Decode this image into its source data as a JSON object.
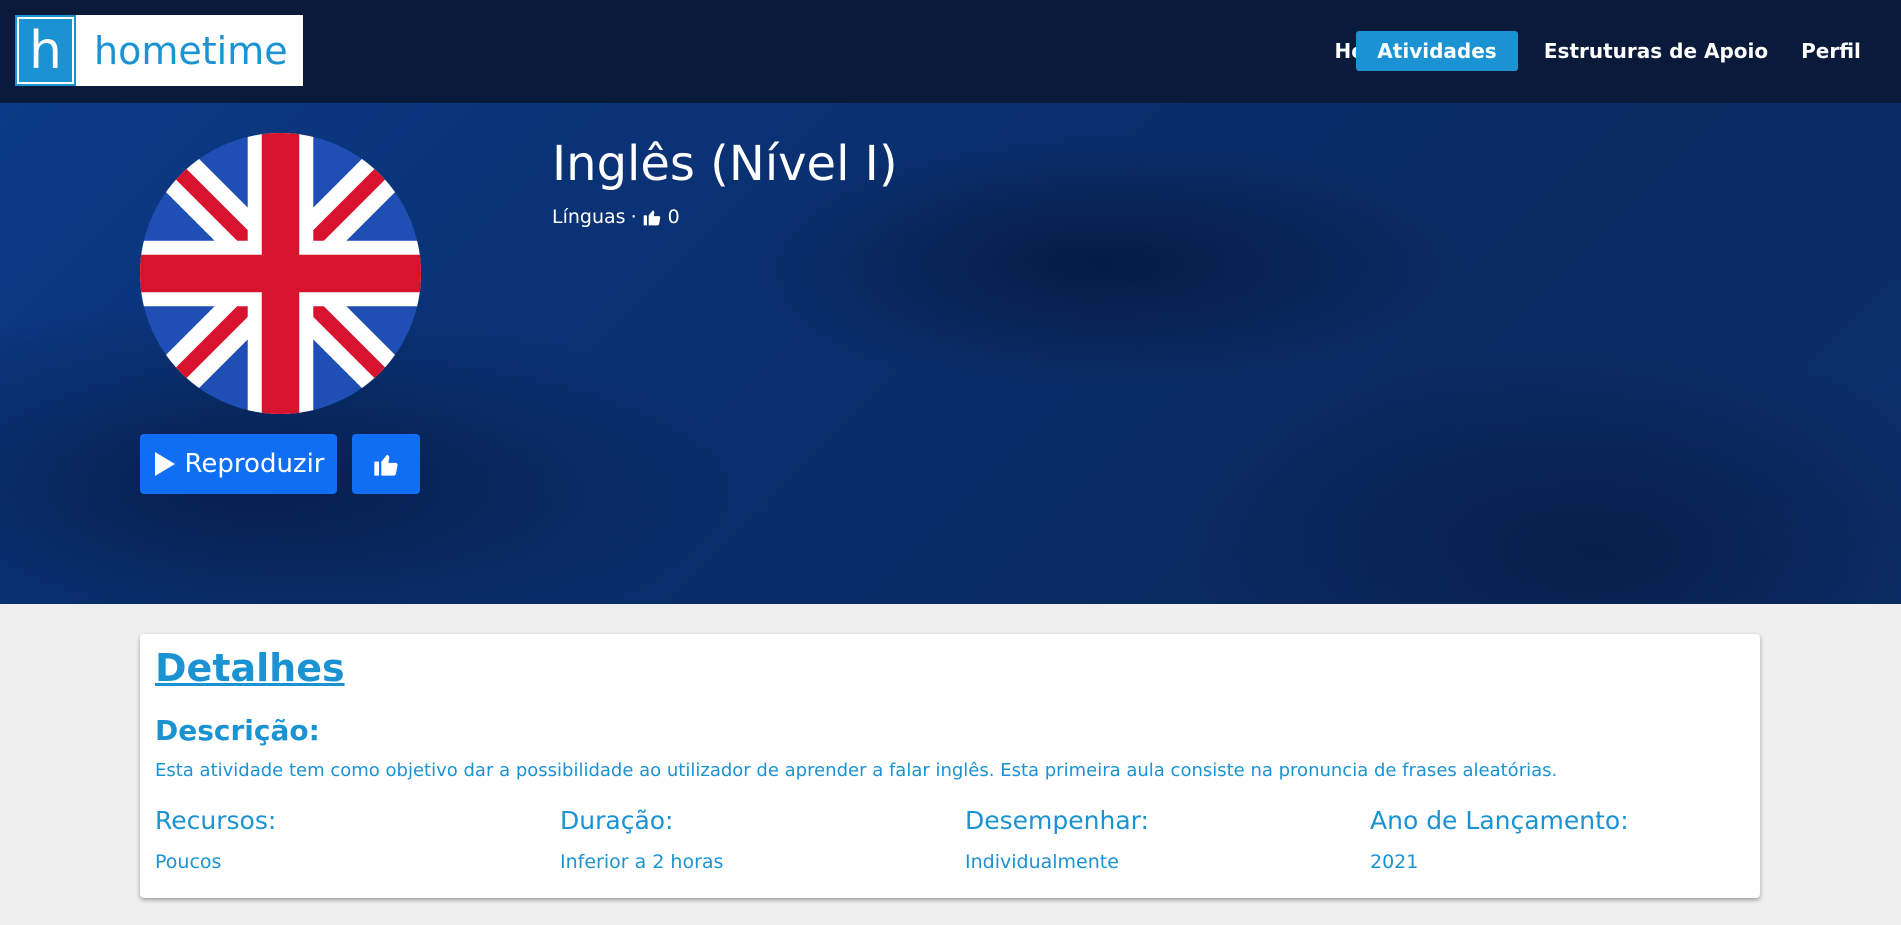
{
  "nav": {
    "logo_letter": "h",
    "logo_text": "hometime",
    "links": [
      {
        "label": "Home"
      },
      {
        "label": "Atividades",
        "active": true
      },
      {
        "label": "Estruturas de Apoio"
      },
      {
        "label": "Perfil"
      }
    ],
    "accent_color": "#1b93d3"
  },
  "activity": {
    "title": "Inglês (Nível I)",
    "category": "Línguas",
    "separator": "·",
    "likes": "0",
    "image_icon": "uk-flag-icon",
    "play_label": "Reproduzir",
    "like_icon": "thumbs-up-icon",
    "button_color": "#0f6ef3"
  },
  "details": {
    "title": "Detalhes",
    "description_label": "Descrição:",
    "description": "Esta atividade tem como objetivo dar a possibilidade ao utilizador de aprender a falar inglês. Esta primeira aula consiste na pronuncia de frases aleatórias.",
    "fields": [
      {
        "label": "Recursos:",
        "value": "Poucos"
      },
      {
        "label": "Duração:",
        "value": "Inferior a 2 horas"
      },
      {
        "label": "Desempenhar:",
        "value": "Individualmente"
      },
      {
        "label": "Ano de Lançamento:",
        "value": "2021"
      }
    ]
  }
}
